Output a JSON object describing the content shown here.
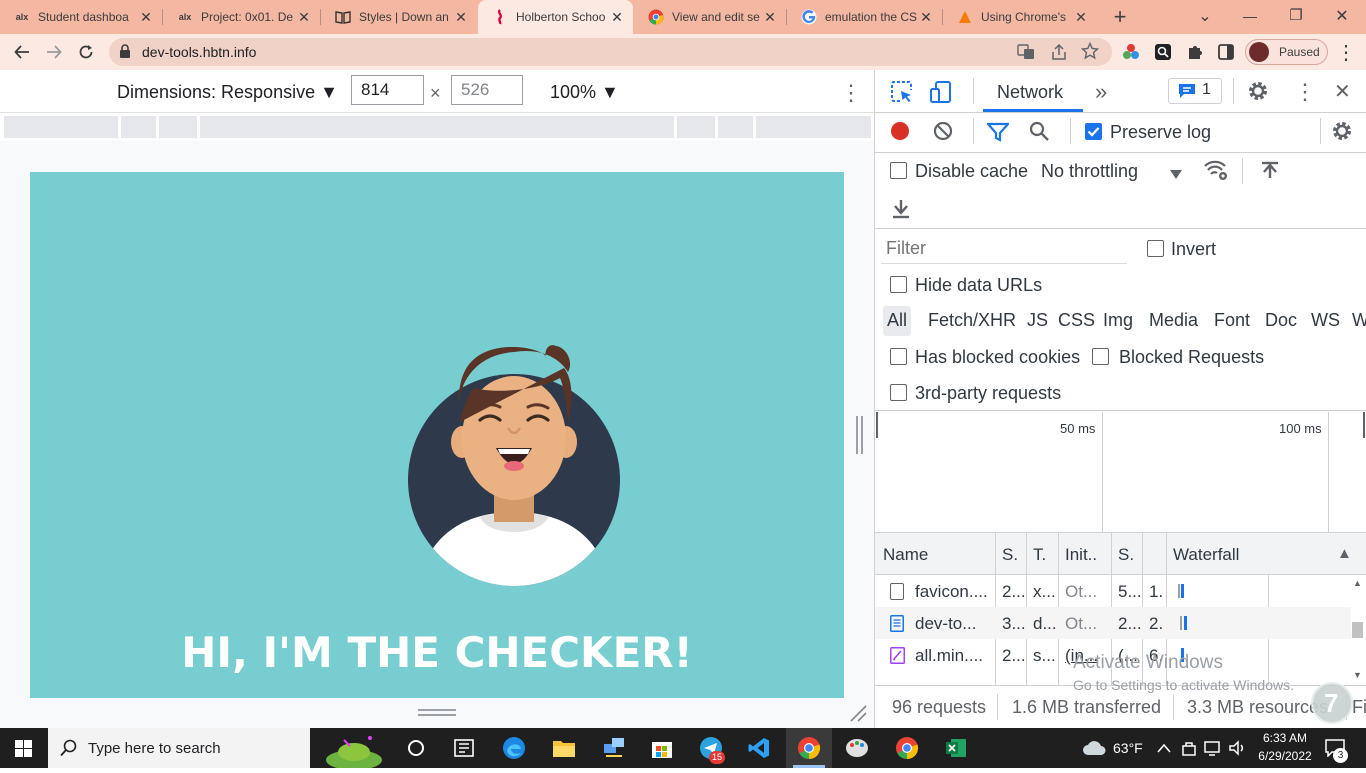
{
  "tabs": [
    {
      "favicon": "alx",
      "title": "Student dashboa"
    },
    {
      "favicon": "alx",
      "title": "Project: 0x01. De"
    },
    {
      "favicon": "book-icon",
      "title": "Styles | Down an"
    },
    {
      "favicon": "holberton-icon",
      "title": "Holberton Schoo",
      "active": true
    },
    {
      "favicon": "chrome-icon",
      "title": "View and edit se"
    },
    {
      "favicon": "google-icon",
      "title": "emulation the CS"
    },
    {
      "favicon": "tutorial-icon",
      "title": "Using Chrome's"
    }
  ],
  "tab_close": "✕",
  "new_tab": "+",
  "window_controls": {
    "list": "⌄",
    "minimize": "—",
    "restore": "❐",
    "close": "✕"
  },
  "url": "dev-tools.hbtn.info",
  "profile_status": "Paused",
  "device_toolbar": {
    "dimensions_label": "Dimensions: Responsive ▼",
    "width": "814",
    "times": "×",
    "height": "526",
    "zoom": "100% ▼",
    "more": "⋮"
  },
  "page": {
    "headline": "HI, I'M THE CHECKER!"
  },
  "devtools": {
    "active_tab": "Network",
    "more_tabs": "»",
    "issues_count": "1",
    "preserve_log": "Preserve log",
    "disable_cache": "Disable cache",
    "throttling": "No throttling",
    "filter_placeholder": "Filter",
    "invert": "Invert",
    "hide_data_urls": "Hide data URLs",
    "filter_types": [
      "All",
      "Fetch/XHR",
      "JS",
      "CSS",
      "Img",
      "Media",
      "Font",
      "Doc",
      "WS",
      "W"
    ],
    "has_blocked_cookies": "Has blocked cookies",
    "blocked_requests": "Blocked Requests",
    "third_party": "3rd-party requests",
    "timeline_ticks": [
      "50 ms",
      "100 ms"
    ],
    "columns": [
      "Name",
      "S.",
      "T.",
      "Init..",
      "S.",
      "",
      "Waterfall"
    ],
    "sort_indicator": "▲",
    "rows": [
      {
        "icon": "blank-file-icon",
        "name": "favicon....",
        "status": "2...",
        "type": "x...",
        "initiator": "Ot...",
        "size": "5...",
        "time": "1."
      },
      {
        "icon": "document-icon",
        "name": "dev-to...",
        "status": "3...",
        "type": "d...",
        "initiator": "Ot...",
        "size": "2...",
        "time": "2."
      },
      {
        "icon": "stylesheet-icon",
        "name": "all.min....",
        "status": "2...",
        "type": "s...",
        "initiator": "(in...",
        "size": "(...",
        "time": "6."
      }
    ],
    "summary": {
      "requests": "96 requests",
      "transferred": "1.6 MB transferred",
      "resources": "3.3 MB resources",
      "finish": "Fi"
    }
  },
  "watermark": {
    "line1": "Activate Windows",
    "line2": "Go to Settings to activate Windows."
  },
  "taskbar": {
    "search_placeholder": "Type here to search",
    "weather": "63°F",
    "time": "6:33 AM",
    "date": "6/29/2022",
    "notifications": "3",
    "telegram_badge": "15"
  },
  "colors": {
    "tabstrip": "#f3b7a2",
    "toolbar": "#fce9e2",
    "page_bg": "#78cdd1",
    "accent": "#1a73e8",
    "record": "#d93025"
  }
}
